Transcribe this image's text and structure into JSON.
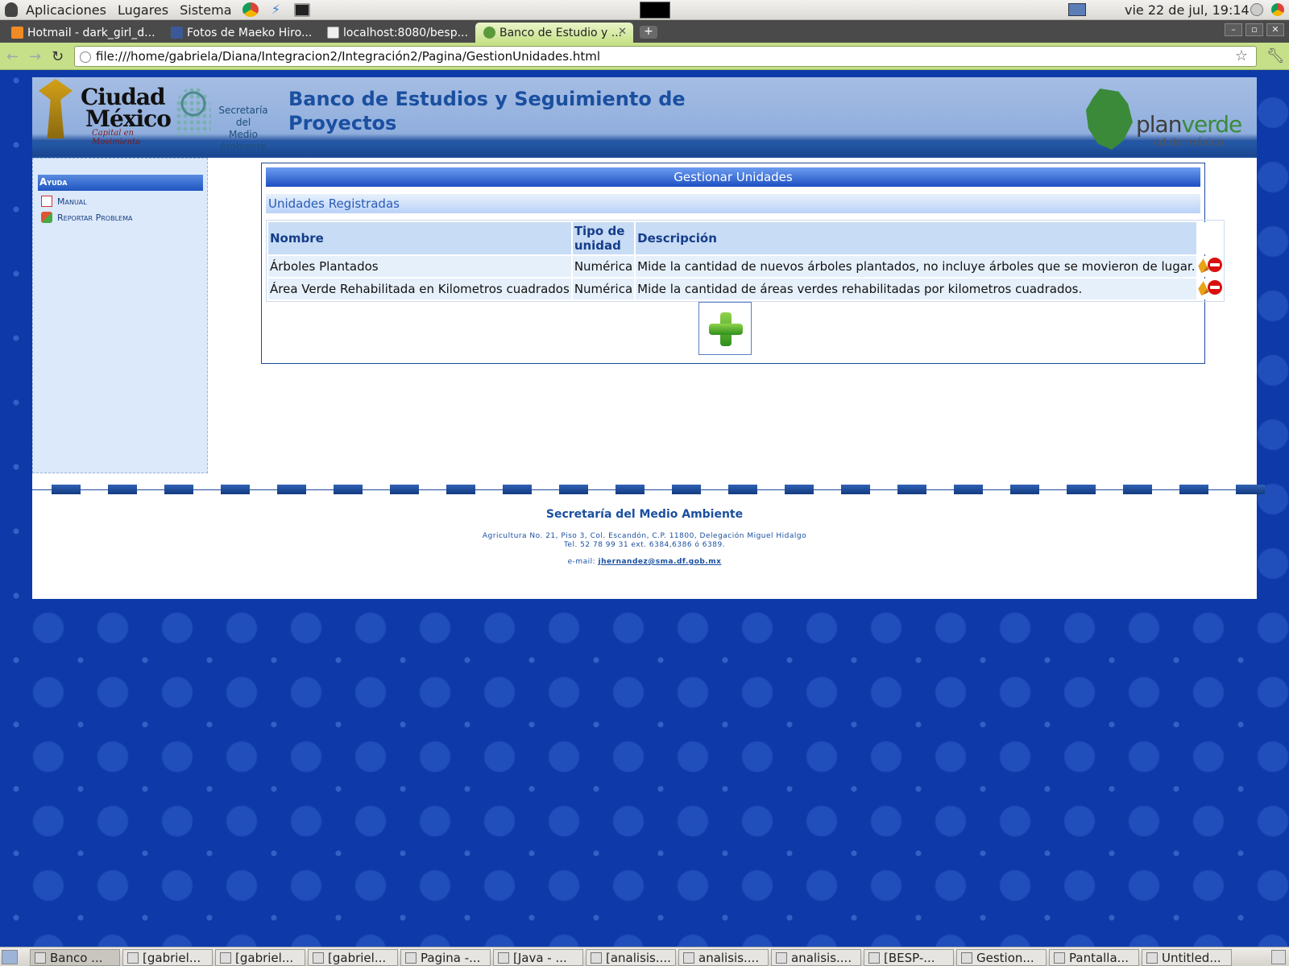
{
  "top_panel": {
    "menus": [
      "Aplicaciones",
      "Lugares",
      "Sistema"
    ],
    "clock": "vie 22 de jul, 19:14"
  },
  "browser": {
    "tabs": [
      {
        "label": "Hotmail - dark_girl_d...",
        "active": false
      },
      {
        "label": "Fotos de Maeko Hiro...",
        "active": false
      },
      {
        "label": "localhost:8080/besp...",
        "active": false
      },
      {
        "label": "Banco de Estudio y ...",
        "active": true
      }
    ],
    "new_tab": "+",
    "url": "file:///home/gabriela/Diana/Integracion2/Integración2/Pagina/GestionUnidades.html"
  },
  "header": {
    "cdmx_logo": {
      "line1": "Ciudad",
      "line2": "México",
      "tagline": "Capital en Movimiento"
    },
    "sma_logo": {
      "line1": "Secretaría del",
      "line2": "Medio Ambiente"
    },
    "title_line1": "Banco de Estudios y Seguimiento de",
    "title_line2": "Proyectos",
    "planverde": {
      "a": "plan",
      "b": "verde",
      "sub": "cd de méxico"
    }
  },
  "sidebar": {
    "heading": "Ayuda",
    "links": [
      {
        "label": "Manual",
        "icon": "pdf-icon"
      },
      {
        "label": "Reportar Problema",
        "icon": "bug-report-icon"
      }
    ]
  },
  "main": {
    "title": "Gestionar Unidades",
    "subtitle": "Unidades Registradas",
    "columns": [
      "Nombre",
      "Tipo de unidad",
      "Descripción"
    ],
    "rows": [
      {
        "nombre": "Árboles Plantados",
        "tipo": "Numérica",
        "descripcion": "Mide la cantidad de nuevos árboles plantados, no incluye árboles que se movieron de lugar."
      },
      {
        "nombre": "Área Verde Rehabilitada en Kilometros cuadrados",
        "tipo": "Numérica",
        "descripcion": "Mide la cantidad de áreas verdes rehabilitadas por kilometros cuadrados."
      }
    ],
    "add_icon": "plus-icon"
  },
  "footer": {
    "org": "Secretaría del Medio Ambiente",
    "address1": "Agricultura No. 21, Piso 3, Col. Escandón, C.P. 11800, Delegación Miguel Hidalgo",
    "address2": "Tel. 52 78 99 31 ext. 6384,6386 ó 6389.",
    "email_label": "e-mail:",
    "email": "jhernandez@sma.df.gob.mx"
  },
  "taskbar": [
    "Banco ...",
    "[gabriel...",
    "[gabriel...",
    "[gabriel...",
    "Pagina -...",
    "[Java - ...",
    "[analisis....",
    "analisis....",
    "analisis....",
    "[BESP-...",
    "Gestion...",
    "Pantalla...",
    "Untitled..."
  ],
  "colors": {
    "accent": "#1c4fc2",
    "header_text": "#1a4fa0",
    "toolbar": "#c6e08a",
    "background": "#0d3aa8"
  }
}
